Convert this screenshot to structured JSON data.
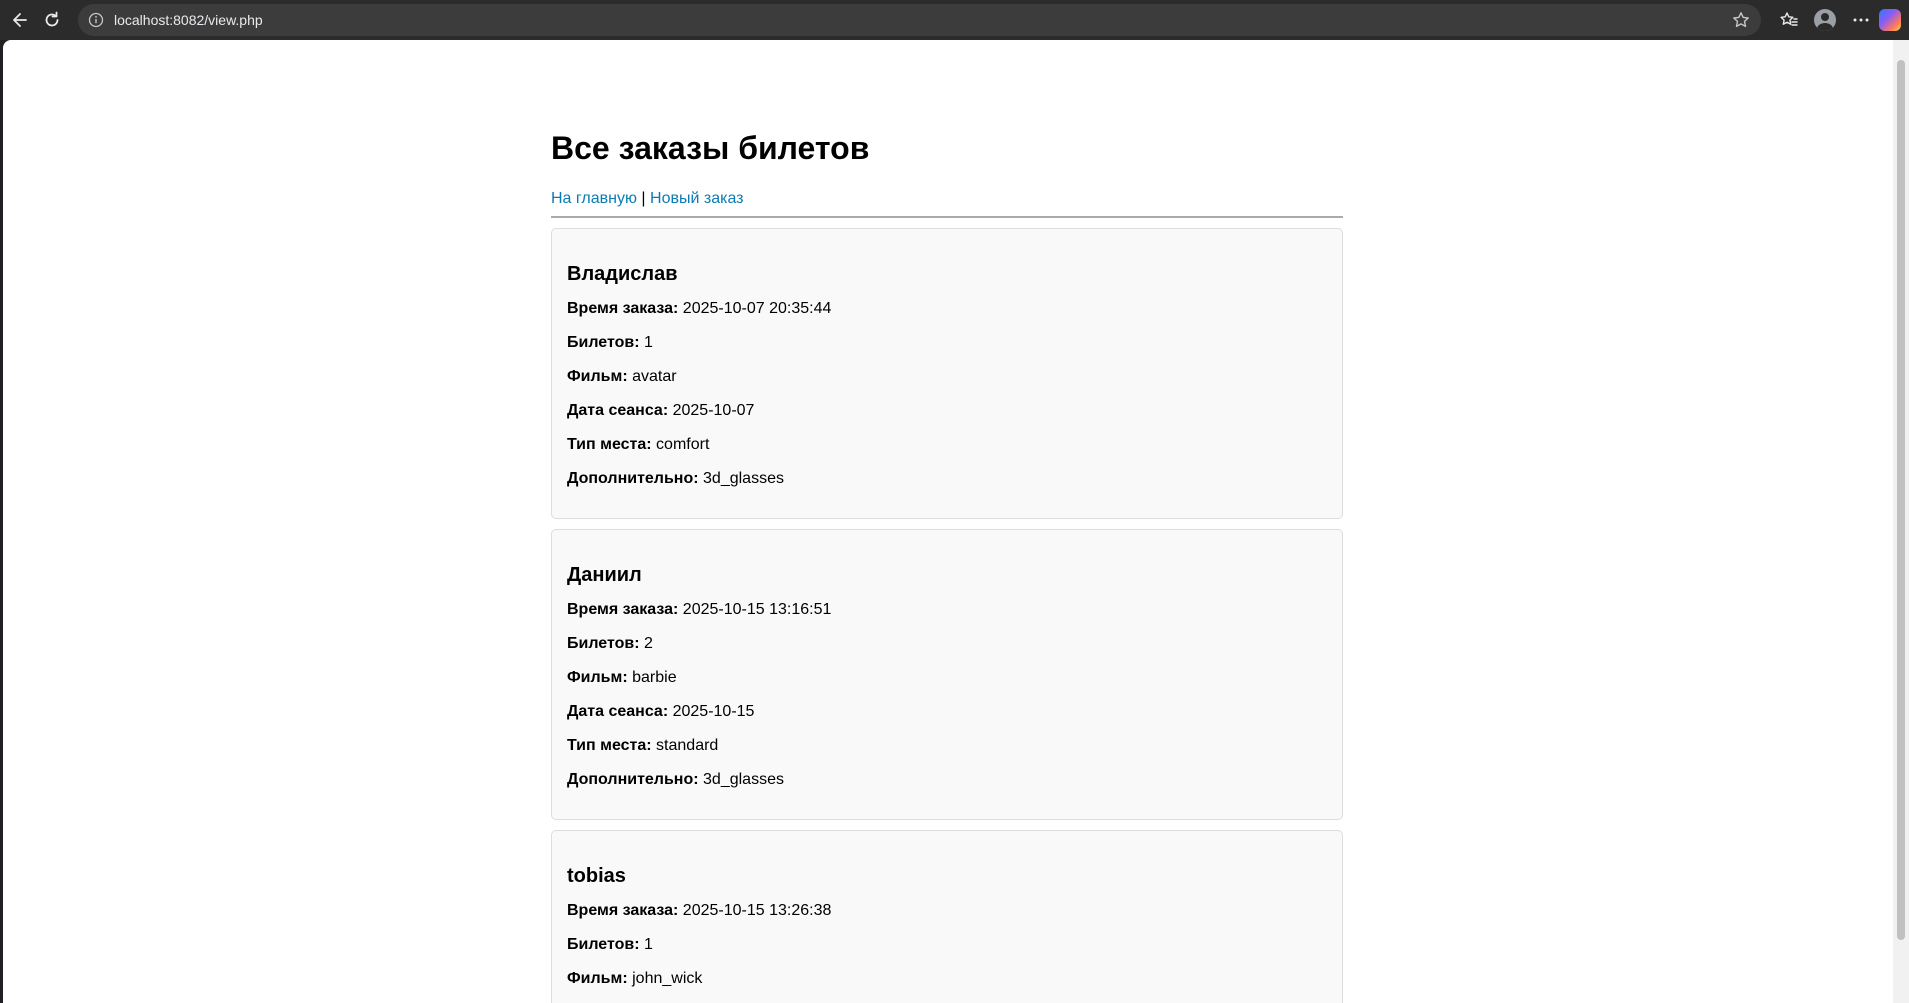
{
  "browser": {
    "url": "localhost:8082/view.php"
  },
  "page": {
    "title": "Все заказы билетов",
    "nav": {
      "home_label": "На главную",
      "separator": "|",
      "new_order_label": "Новый заказ"
    }
  },
  "labels": {
    "time": "Время заказа:",
    "tickets": "Билетов:",
    "film": "Фильм:",
    "date": "Дата сеанса:",
    "seat": "Тип места:",
    "extra": "Дополнительно:"
  },
  "orders": [
    {
      "name": "Владислав",
      "time": "2025-10-07 20:35:44",
      "tickets": "1",
      "film": "avatar",
      "date": "2025-10-07",
      "seat": "comfort",
      "extra": "3d_glasses"
    },
    {
      "name": "Даниил",
      "time": "2025-10-15 13:16:51",
      "tickets": "2",
      "film": "barbie",
      "date": "2025-10-15",
      "seat": "standard",
      "extra": "3d_glasses"
    },
    {
      "name": "tobias",
      "time": "2025-10-15 13:26:38",
      "tickets": "1",
      "film": "john_wick"
    }
  ]
}
